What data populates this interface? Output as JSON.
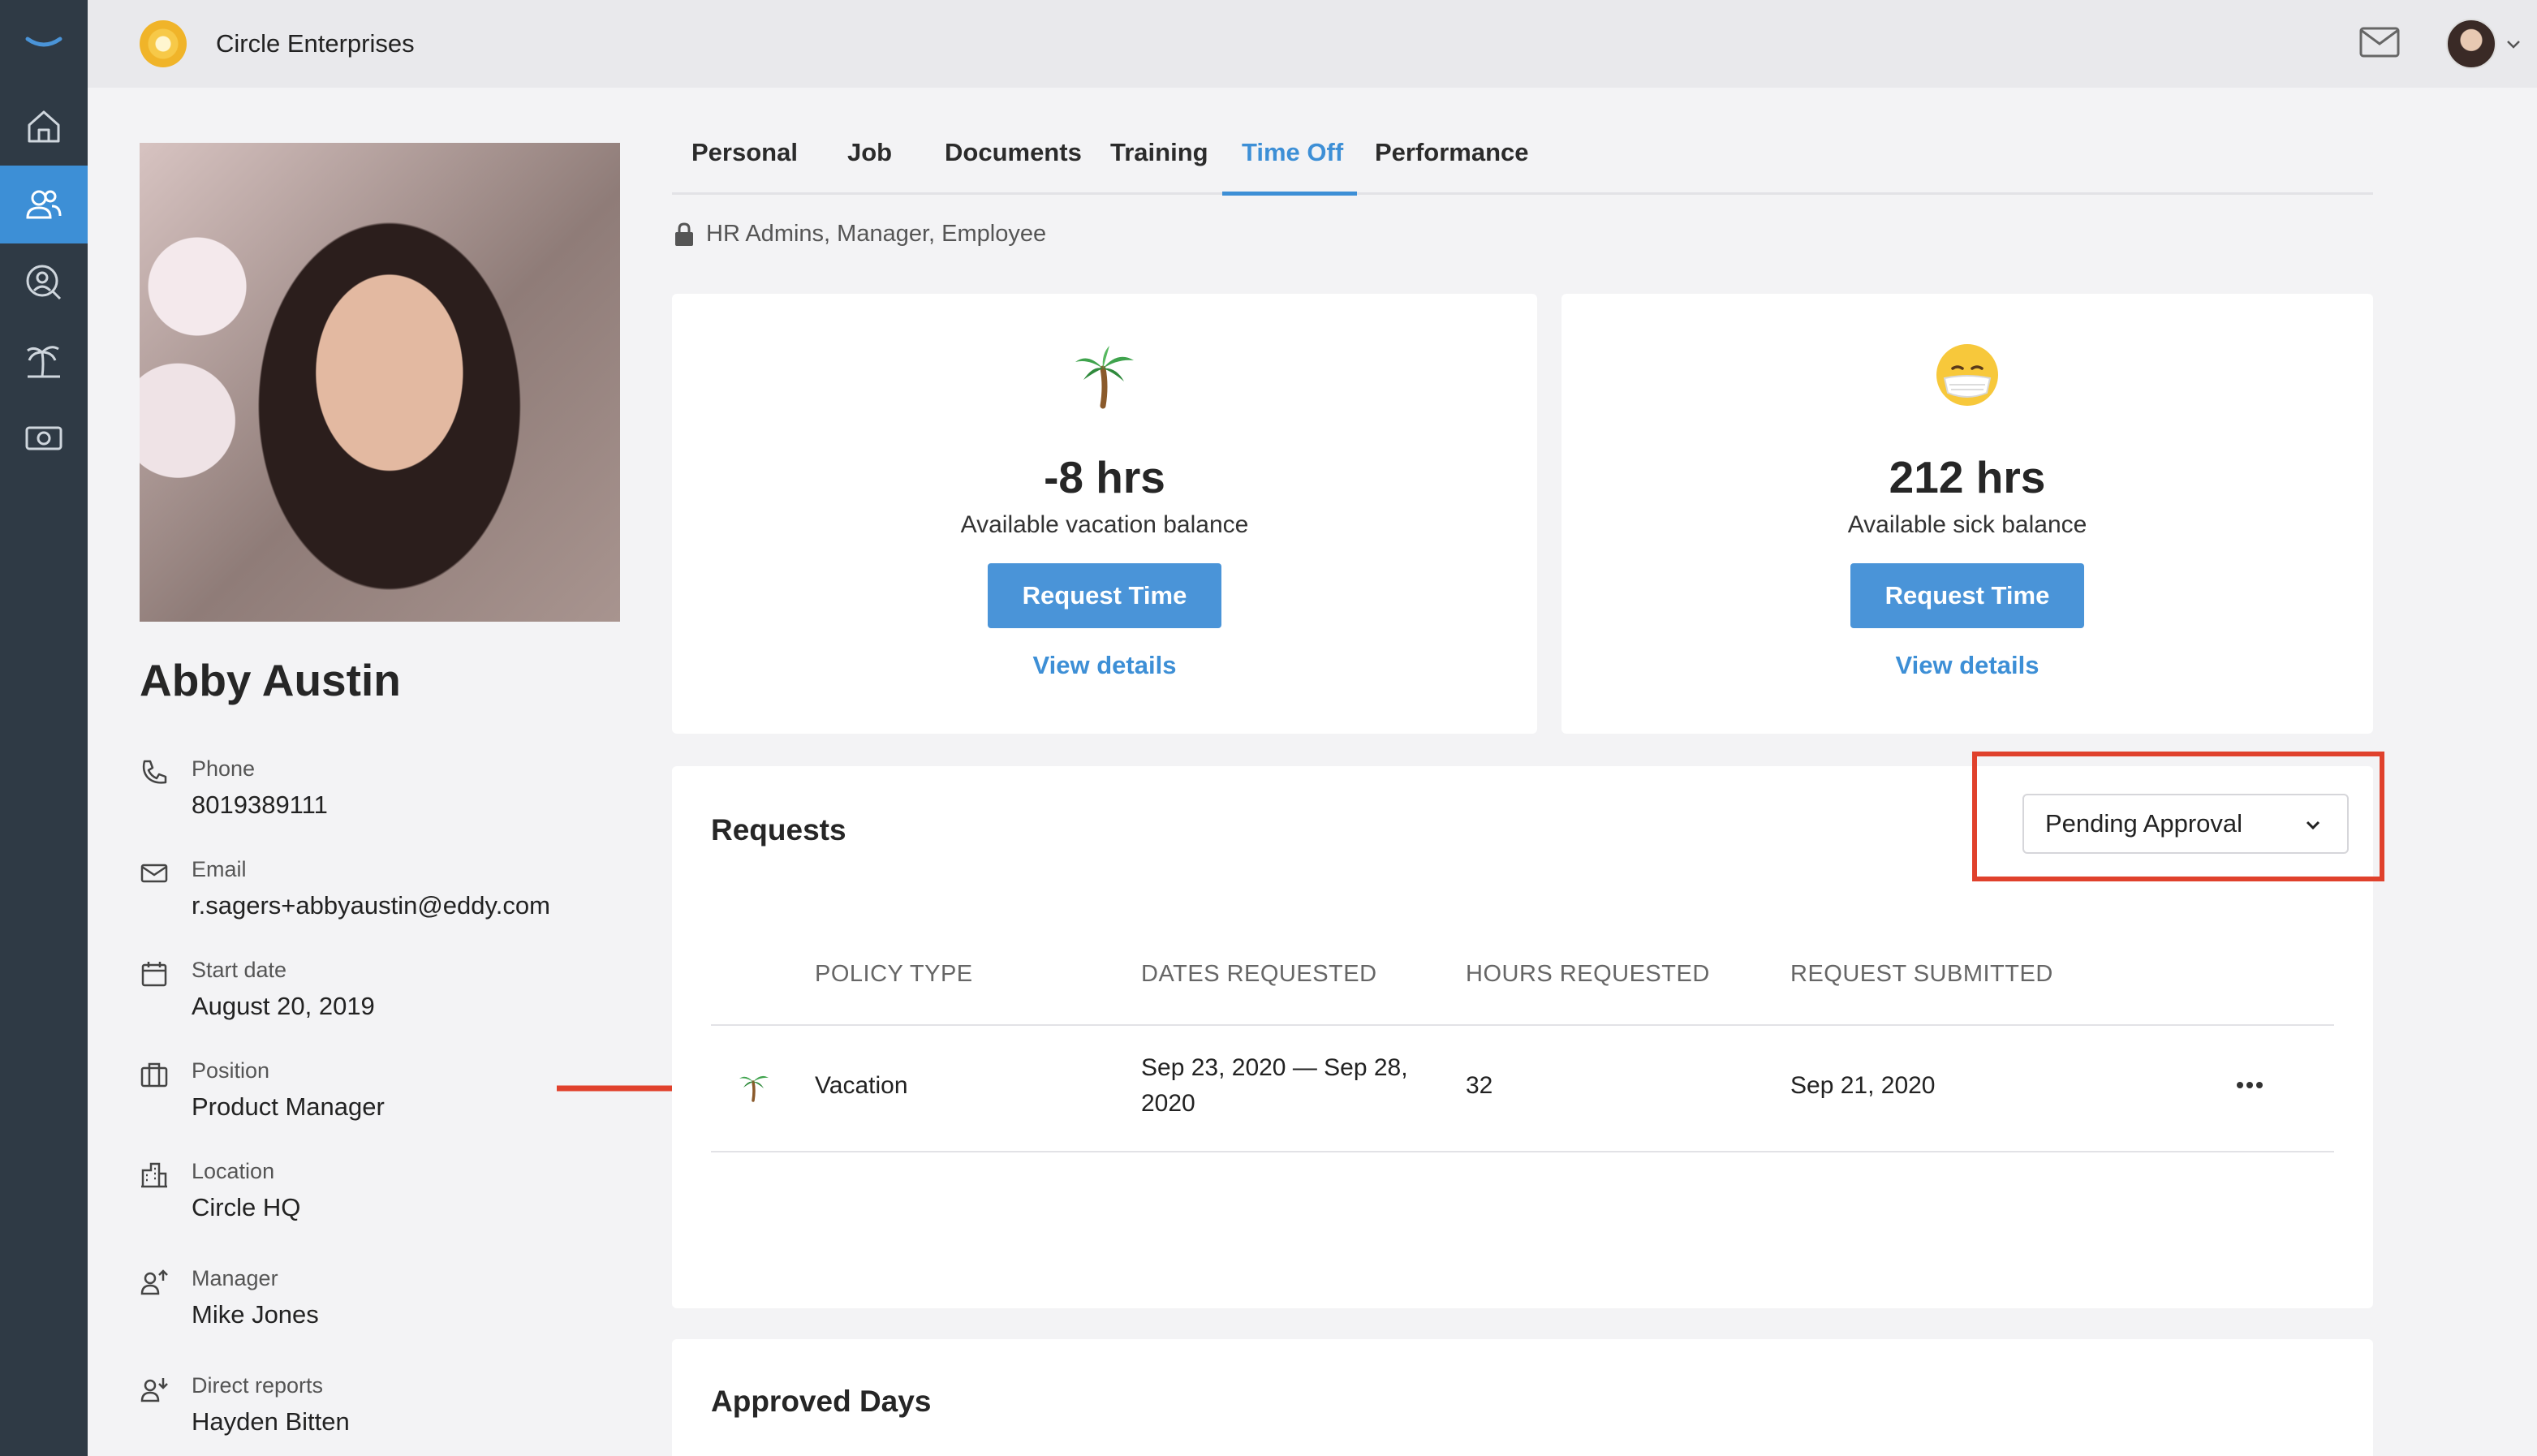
{
  "app": {
    "company_name": "Circle Enterprises",
    "accent_color": "#3d8fd6",
    "sidebar_color": "#2f3a45"
  },
  "sidebar": {
    "items": [
      {
        "icon": "home-icon"
      },
      {
        "icon": "people-icon",
        "active": true
      },
      {
        "icon": "search-person-icon"
      },
      {
        "icon": "palm-tree-icon"
      },
      {
        "icon": "money-icon"
      }
    ]
  },
  "profile": {
    "name": "Abby Austin",
    "fields": [
      {
        "icon": "phone-icon",
        "label": "Phone",
        "value": "8019389111"
      },
      {
        "icon": "email-icon",
        "label": "Email",
        "value": "r.sagers+abbyaustin@eddy.com"
      },
      {
        "icon": "calendar-icon",
        "label": "Start date",
        "value": "August 20, 2019"
      },
      {
        "icon": "briefcase-icon",
        "label": "Position",
        "value": "Product Manager"
      },
      {
        "icon": "building-icon",
        "label": "Location",
        "value": "Circle HQ"
      },
      {
        "icon": "manager-icon",
        "label": "Manager",
        "value": "Mike Jones"
      },
      {
        "icon": "direct-reports-icon",
        "label": "Direct reports",
        "value": "Hayden Bitten"
      }
    ]
  },
  "tabs": [
    "Personal",
    "Job",
    "Documents",
    "Training",
    "Time Off",
    "Performance"
  ],
  "active_tab": "Time Off",
  "permissions_text": "HR Admins, Manager, Employee",
  "balances": {
    "vacation": {
      "emoji": "palm-tree-icon",
      "amount": "-8 hrs",
      "description": "Available vacation balance",
      "button": "Request Time",
      "link": "View details"
    },
    "sick": {
      "emoji": "mask-face-icon",
      "amount": "212 hrs",
      "description": "Available sick balance",
      "button": "Request Time",
      "link": "View details"
    }
  },
  "requests": {
    "title": "Requests",
    "filter_value": "Pending Approval",
    "highlight_color": "#e0412c",
    "columns": [
      "POLICY TYPE",
      "DATES REQUESTED",
      "HOURS REQUESTED",
      "REQUEST SUBMITTED"
    ],
    "rows": [
      {
        "policy_type": "Vacation",
        "dates_line1": "Sep 23, 2020 — Sep 28,",
        "dates_line2": "2020",
        "hours": "32",
        "submitted": "Sep 21, 2020"
      }
    ]
  },
  "approved_days": {
    "title": "Approved Days"
  }
}
